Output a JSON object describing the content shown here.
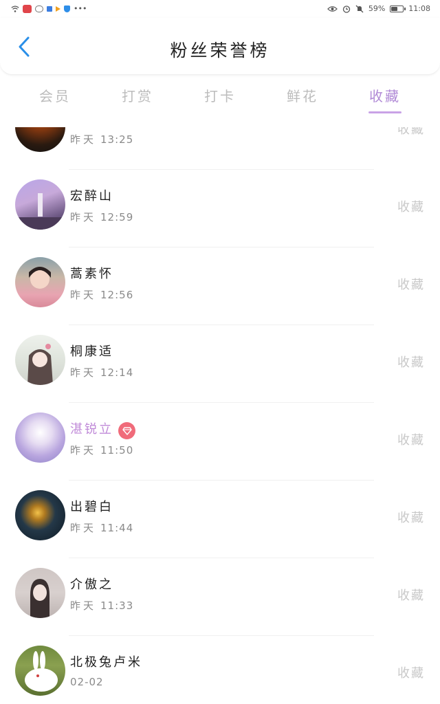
{
  "status_bar": {
    "battery": "59%",
    "battery_level": 0.59,
    "time": "11:08"
  },
  "header": {
    "title": "粉丝荣誉榜"
  },
  "tabs": [
    {
      "label": "会员"
    },
    {
      "label": "打赏"
    },
    {
      "label": "打卡"
    },
    {
      "label": "鲜花"
    },
    {
      "label": "收藏"
    }
  ],
  "active_tab": "收藏",
  "accent_color": "#c9a2e6",
  "list": [
    {
      "name": "",
      "day": "昨天",
      "time": "13:25",
      "action": "收藏"
    },
    {
      "name": "宏醉山",
      "day": "昨天",
      "time": "12:59",
      "action": "收藏"
    },
    {
      "name": "蒿素怀",
      "day": "昨天",
      "time": "12:56",
      "action": "收藏"
    },
    {
      "name": "桐康适",
      "day": "昨天",
      "time": "12:14",
      "action": "收藏"
    },
    {
      "name": "湛锐立",
      "day": "昨天",
      "time": "11:50",
      "action": "收藏",
      "vip": true
    },
    {
      "name": "出碧白",
      "day": "昨天",
      "time": "11:44",
      "action": "收藏"
    },
    {
      "name": "介傲之",
      "day": "昨天",
      "time": "11:33",
      "action": "收藏"
    },
    {
      "name": "北极兔卢米",
      "day": "",
      "time": "02-02",
      "action": "收藏"
    }
  ]
}
